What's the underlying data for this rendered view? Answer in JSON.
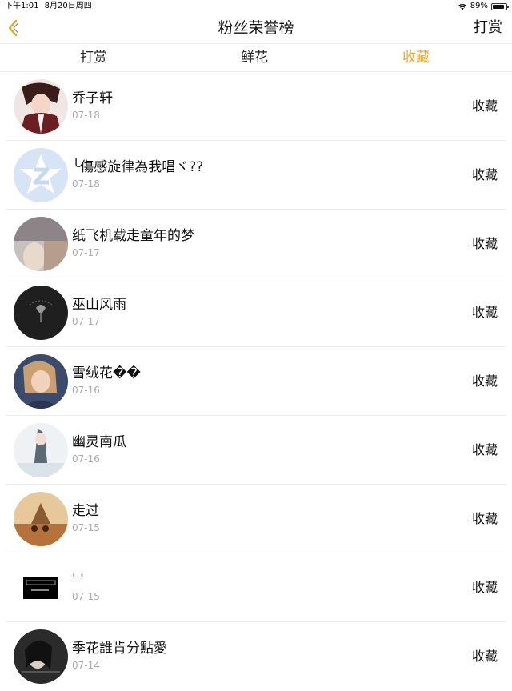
{
  "status": {
    "time": "下午1:01",
    "date": "8月20日周四",
    "battery": "89%",
    "battery_level": 0.89
  },
  "nav": {
    "title": "粉丝荣誉榜",
    "action": "打赏",
    "back_icon": "chevron-left-icon"
  },
  "tabs": [
    {
      "label": "打赏",
      "active": false
    },
    {
      "label": "鲜花",
      "active": false
    },
    {
      "label": "收藏",
      "active": true
    }
  ],
  "colors": {
    "accent": "#f2a623"
  },
  "items": [
    {
      "name": "乔子轩",
      "date": "07-18",
      "action": "收藏"
    },
    {
      "name": "╰傷感旋律為我唱ヾ??",
      "date": "07-18",
      "action": "收藏"
    },
    {
      "name": "纸飞机载走童年的梦",
      "date": "07-17",
      "action": "收藏"
    },
    {
      "name": "巫山风雨",
      "date": "07-17",
      "action": "收藏"
    },
    {
      "name": "雪绒花��",
      "date": "07-16",
      "action": "收藏"
    },
    {
      "name": "幽灵南瓜",
      "date": "07-16",
      "action": "收藏"
    },
    {
      "name": "走过",
      "date": "07-15",
      "action": "收藏"
    },
    {
      "name": "' '",
      "date": "07-15",
      "action": "收藏"
    },
    {
      "name": "季花誰肯分點愛",
      "date": "07-14",
      "action": "收藏"
    }
  ]
}
